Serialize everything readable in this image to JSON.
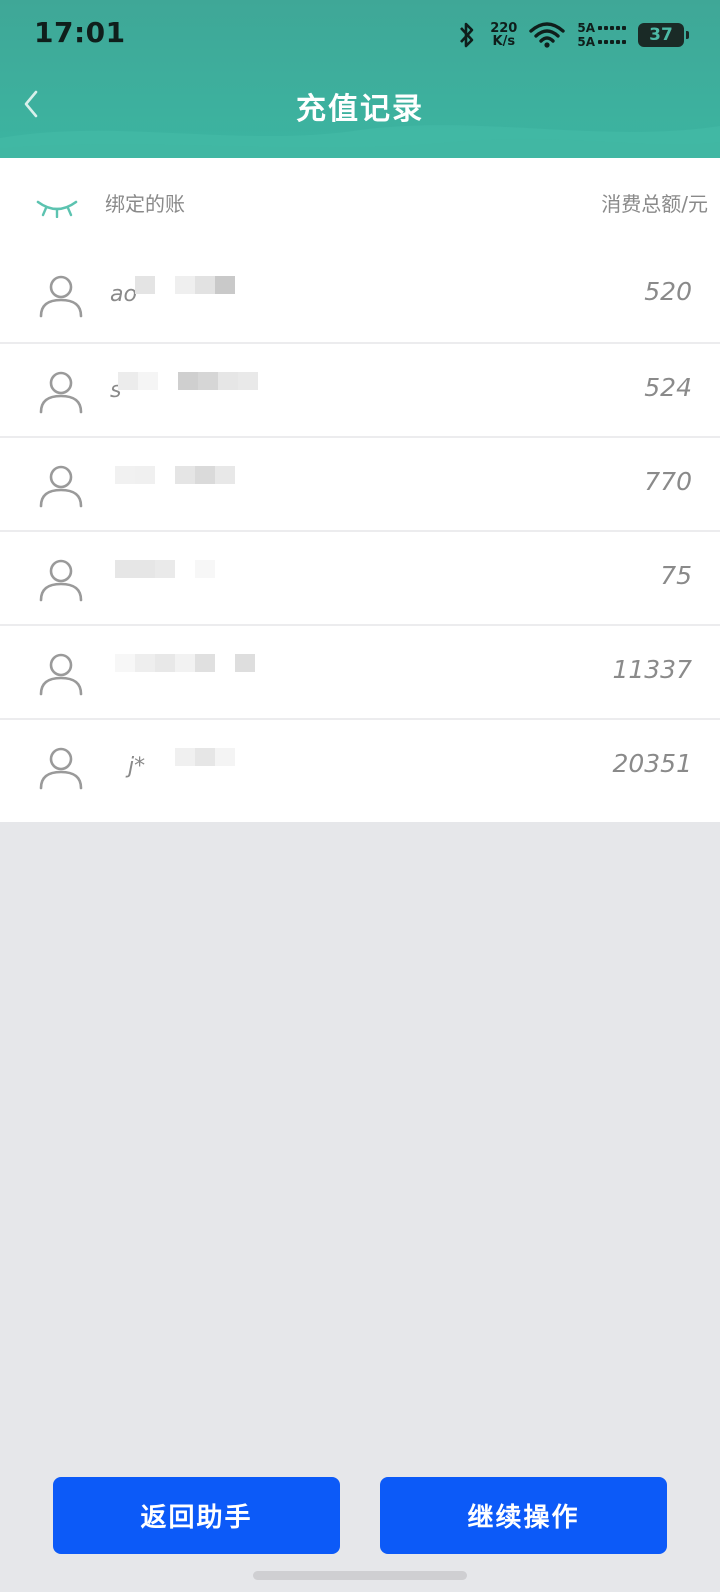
{
  "status_bar": {
    "time": "17:01",
    "net_speed_value": "220",
    "net_speed_unit": "K/s",
    "sim1": "5A",
    "sim2": "5A",
    "battery": "37"
  },
  "header": {
    "title": "充值记录"
  },
  "list_header": {
    "left_label": "绑定的账",
    "right_label": "消费总额/元"
  },
  "rows": [
    {
      "account": "ao",
      "amount": "520"
    },
    {
      "account": "s",
      "amount": "524"
    },
    {
      "account": "",
      "amount": "770"
    },
    {
      "account": "",
      "amount": "75"
    },
    {
      "account": "",
      "amount": "11337"
    },
    {
      "account": "j*",
      "amount": "20351"
    }
  ],
  "buttons": {
    "back_to_assistant": "返回助手",
    "continue": "继续操作"
  },
  "colors": {
    "header": "#3FA797",
    "primary_button": "#0C5AF8",
    "page_bg": "#E6E7EA"
  }
}
